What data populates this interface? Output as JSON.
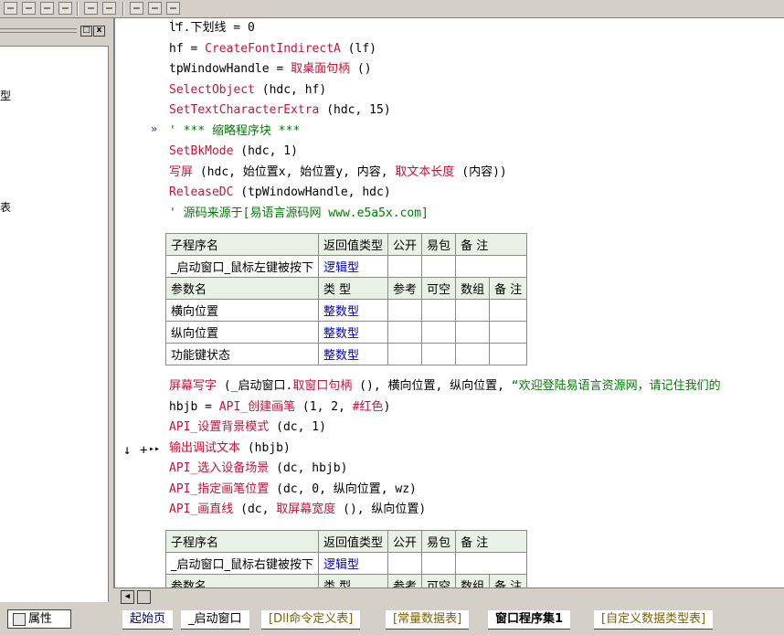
{
  "left_panel": {
    "tree_items": [
      {
        "text": "型"
      },
      {
        "text": "表"
      }
    ],
    "restore_label": "□",
    "close_label": "x"
  },
  "code": {
    "lines": [
      {
        "parts": [
          {
            "t": "lf.下划线 = 0",
            "c": "plain"
          }
        ]
      },
      {
        "parts": [
          {
            "t": "hf = ",
            "c": "plain"
          },
          {
            "t": "CreateFontIndirectA",
            "c": "fn"
          },
          {
            "t": " (lf)",
            "c": "plain"
          }
        ]
      },
      {
        "parts": [
          {
            "t": "tpWindowHandle = ",
            "c": "plain"
          },
          {
            "t": "取桌面句柄",
            "c": "fn"
          },
          {
            "t": " ()",
            "c": "plain"
          }
        ]
      },
      {
        "parts": [
          {
            "t": "SelectObject",
            "c": "fn"
          },
          {
            "t": " (hdc, hf)",
            "c": "plain"
          }
        ]
      },
      {
        "parts": [
          {
            "t": "SetTextCharacterExtra",
            "c": "fn"
          },
          {
            "t": " (hdc, 15)",
            "c": "plain"
          }
        ]
      },
      {
        "parts": [
          {
            "t": "' *** 缩略程序块 ***",
            "c": "cmt"
          }
        ]
      },
      {
        "parts": [
          {
            "t": "SetBkMode",
            "c": "fn"
          },
          {
            "t": " (hdc, 1)",
            "c": "plain"
          }
        ]
      },
      {
        "parts": [
          {
            "t": "写屏",
            "c": "fn"
          },
          {
            "t": " (hdc, 始位置x, 始位置y, 内容, ",
            "c": "plain"
          },
          {
            "t": "取文本长度",
            "c": "fn"
          },
          {
            "t": " (内容))",
            "c": "plain"
          }
        ]
      },
      {
        "parts": [
          {
            "t": "ReleaseDC",
            "c": "fn"
          },
          {
            "t": " (tpWindowHandle, hdc)",
            "c": "plain"
          }
        ]
      },
      {
        "parts": [
          {
            "t": "' 源码来源于[易语言源码网 www.e5a5x.com]",
            "c": "cmt"
          }
        ]
      }
    ],
    "lines2": [
      {
        "parts": [
          {
            "t": "屏幕写字",
            "c": "fn"
          },
          {
            "t": " (_启动窗口.",
            "c": "plain"
          },
          {
            "t": "取窗口句柄",
            "c": "fn"
          },
          {
            "t": " (), 横向位置, 纵向位置, ",
            "c": "plain"
          },
          {
            "t": "“欢迎登陆易语言资源网，请记住我们的",
            "c": "str"
          }
        ]
      },
      {
        "parts": [
          {
            "t": "hbjb = ",
            "c": "plain"
          },
          {
            "t": "API_创建画笔",
            "c": "fn"
          },
          {
            "t": " (1, 2, ",
            "c": "plain"
          },
          {
            "t": "#红色",
            "c": "fn"
          },
          {
            "t": ")",
            "c": "plain"
          }
        ]
      },
      {
        "parts": [
          {
            "t": "API_设置背景模式",
            "c": "fn"
          },
          {
            "t": " (dc, 1)",
            "c": "plain"
          }
        ]
      },
      {
        "parts": [
          {
            "t": "输出调试文本",
            "c": "fn"
          },
          {
            "t": " (hbjb)",
            "c": "plain"
          }
        ]
      },
      {
        "parts": [
          {
            "t": "API_选入设备场景",
            "c": "fn"
          },
          {
            "t": " (dc, hbjb)",
            "c": "plain"
          }
        ]
      },
      {
        "parts": [
          {
            "t": "API_指定画笔位置",
            "c": "fn"
          },
          {
            "t": " (dc, 0, 纵向位置, wz)",
            "c": "plain"
          }
        ]
      },
      {
        "parts": [
          {
            "t": "API_画直线",
            "c": "fn"
          },
          {
            "t": " (dc, ",
            "c": "plain"
          },
          {
            "t": "取屏幕宽度",
            "c": "fn"
          },
          {
            "t": " (), 纵向位置)",
            "c": "plain"
          }
        ]
      }
    ]
  },
  "table1": {
    "header": [
      "子程序名",
      "返回值类型",
      "公开",
      "易包",
      "备 注"
    ],
    "sub_row": [
      "_启动窗口_鼠标左键被按下",
      "逻辑型",
      "",
      "",
      ""
    ],
    "param_header": [
      "参数名",
      "类 型",
      "参考",
      "可空",
      "数组",
      "备 注"
    ],
    "params": [
      [
        "横向位置",
        "整数型",
        "",
        "",
        "",
        ""
      ],
      [
        "纵向位置",
        "整数型",
        "",
        "",
        "",
        ""
      ],
      [
        "功能键状态",
        "整数型",
        "",
        "",
        "",
        ""
      ]
    ]
  },
  "table2": {
    "header": [
      "子程序名",
      "返回值类型",
      "公开",
      "易包",
      "备 注"
    ],
    "sub_row": [
      "_启动窗口_鼠标右键被按下",
      "逻辑型",
      "",
      "",
      ""
    ],
    "param_header": [
      "参数名",
      "类 型",
      "参考",
      "可空",
      "数组",
      "备 注"
    ]
  },
  "markers": {
    "collapse": "»",
    "arrow_down": "↓",
    "plus": "+",
    "small_arrow": "▸"
  },
  "bottom": {
    "prop_tab": "属性",
    "tabs": [
      "起始页",
      "_启动窗口",
      "[Dll命令定义表]",
      "[常量数据表]",
      "窗口程序集1",
      "[自定义数据类型表]"
    ],
    "active_tab": "窗口程序集1"
  },
  "colors": {
    "function": "#c0143c",
    "comment": "#007a00",
    "link": "#0000c0",
    "table_header": "#e9f0e4",
    "chrome": "#d4d0c8"
  }
}
